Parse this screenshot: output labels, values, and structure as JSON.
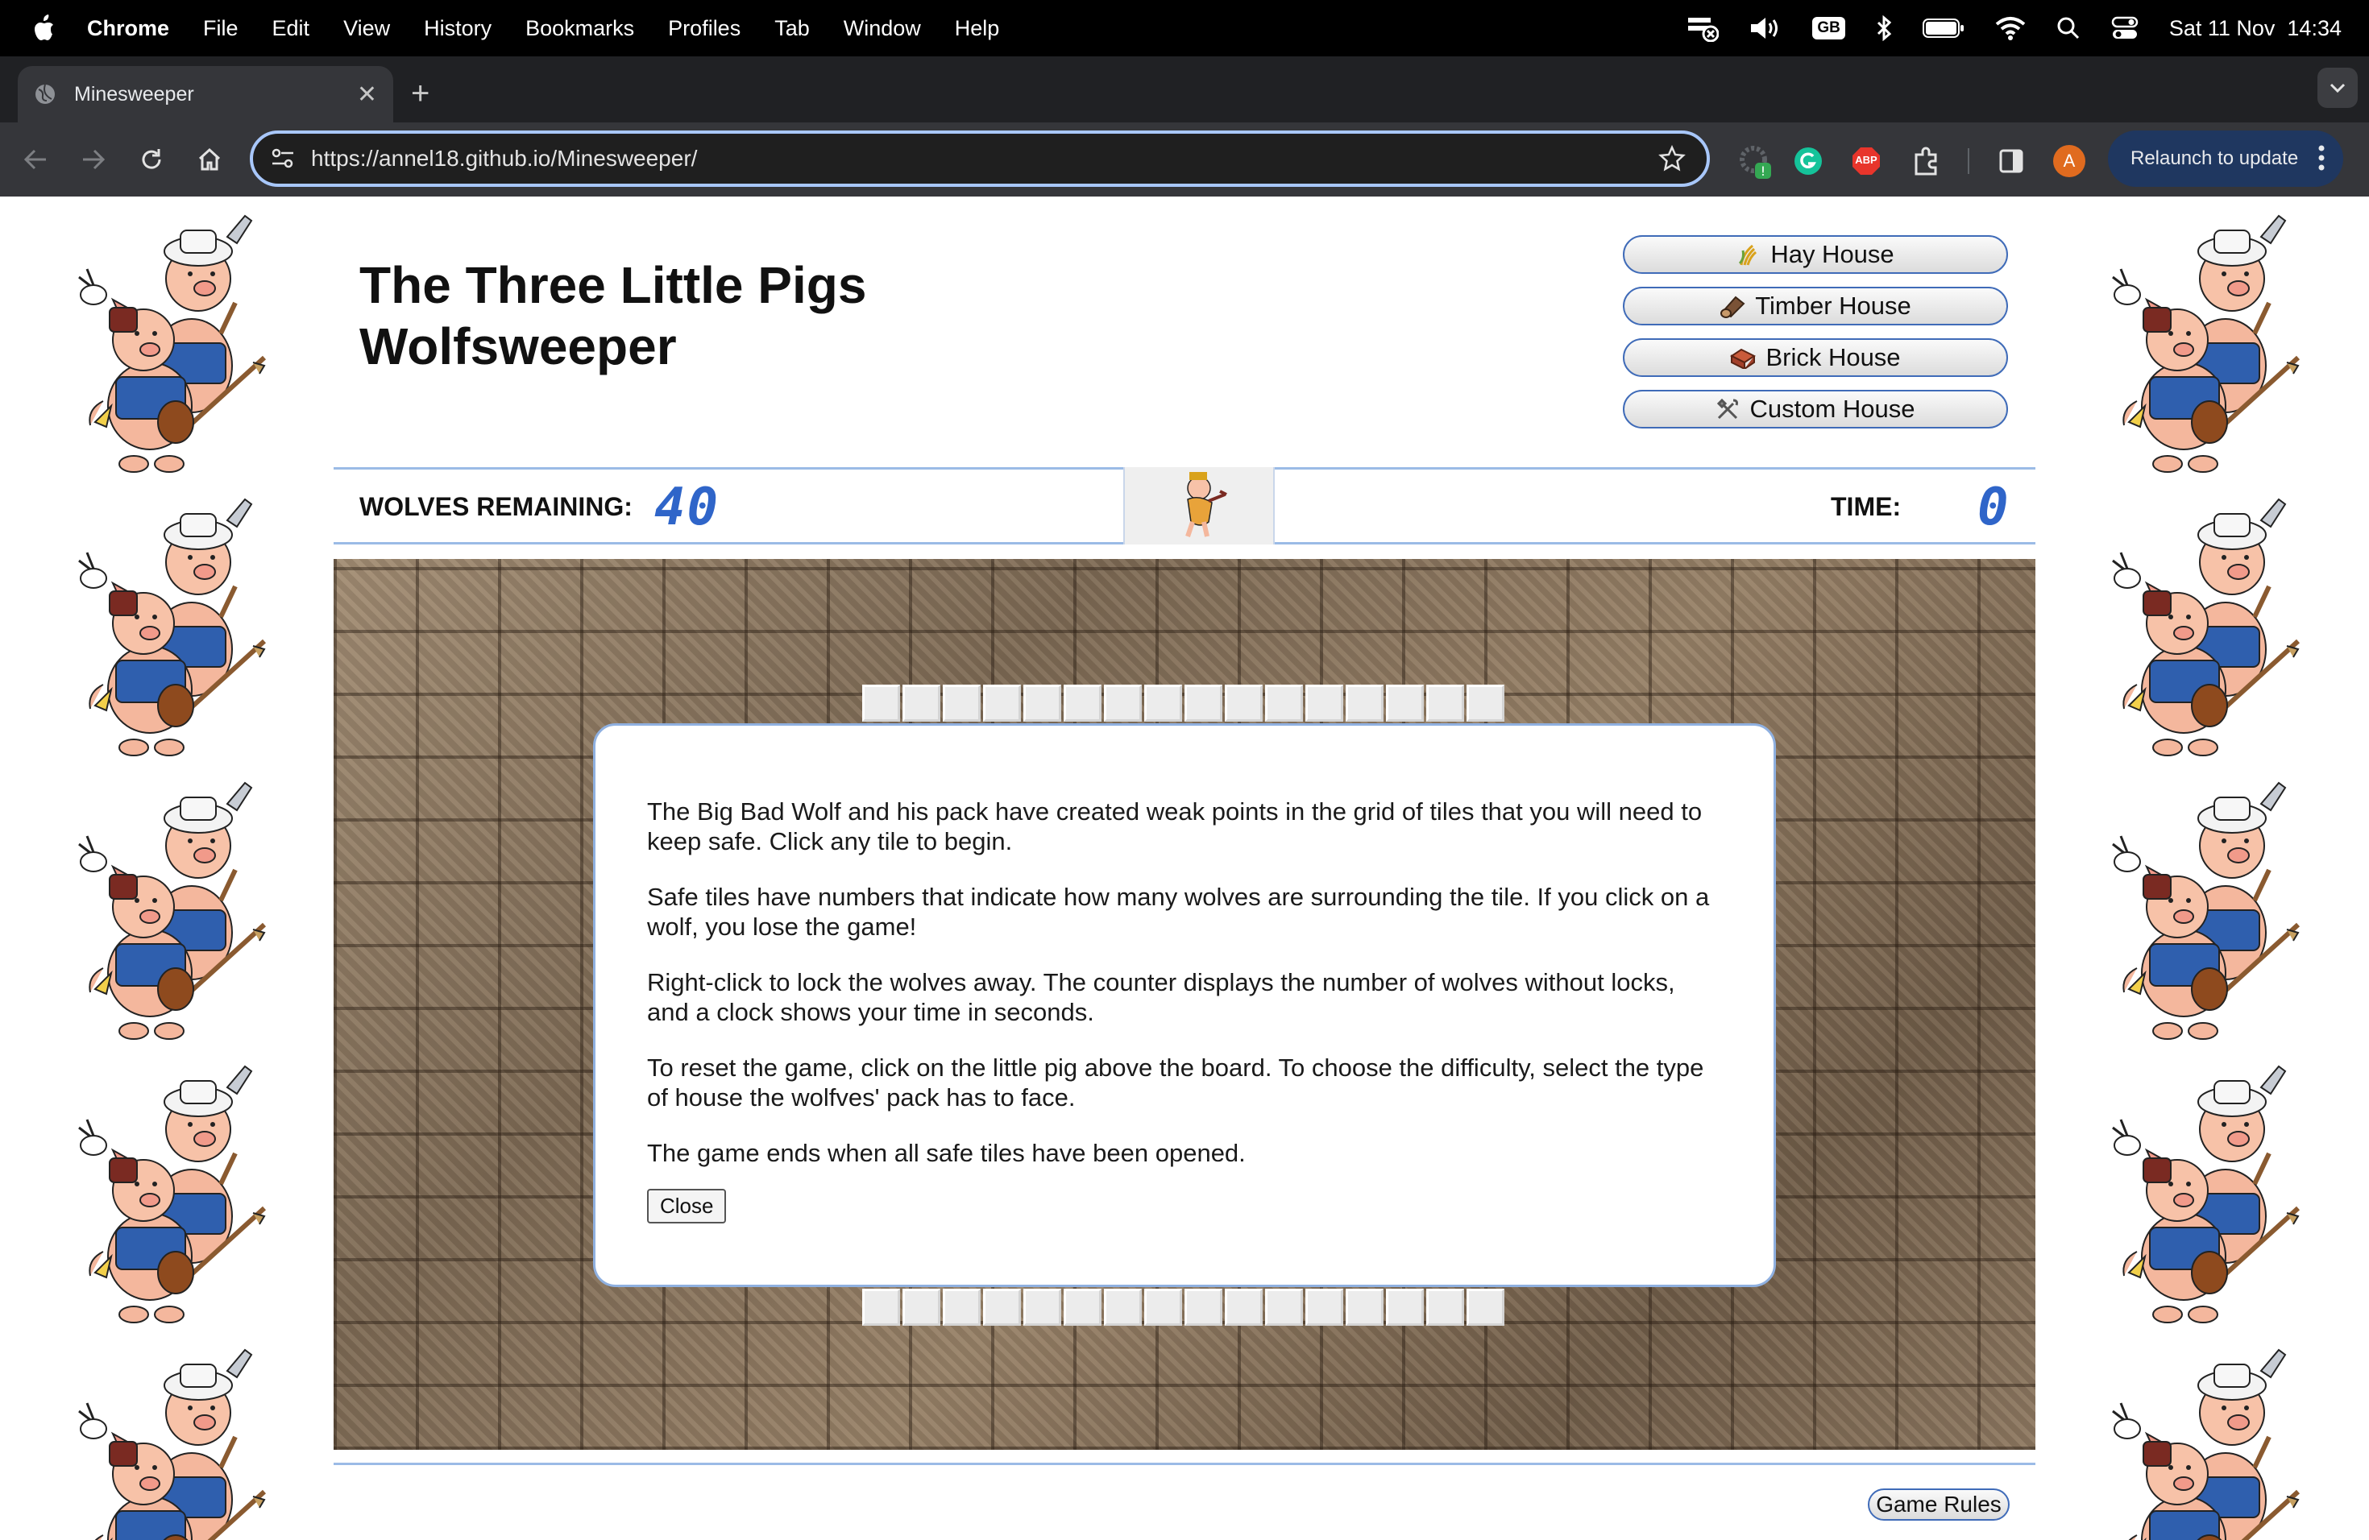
{
  "menubar": {
    "app_name": "Chrome",
    "items": [
      "File",
      "Edit",
      "View",
      "History",
      "Bookmarks",
      "Profiles",
      "Tab",
      "Window",
      "Help"
    ],
    "keyboard_badge": "GB",
    "clock": "Sat 11 Nov  14:34"
  },
  "browser": {
    "tab_title": "Minesweeper",
    "url_prefix": "https://",
    "url_host": "annel18.github.io",
    "url_path": "/Minesweeper/",
    "extension_abp": "ABP",
    "profile_initial": "A",
    "relaunch_label": "Relaunch to update"
  },
  "game": {
    "title": "The Three Little Pigs\nWolfsweeper",
    "houses": [
      {
        "icon": "hay-icon",
        "label": "Hay House"
      },
      {
        "icon": "timber-icon",
        "label": "Timber House"
      },
      {
        "icon": "brick-icon",
        "label": "Brick House"
      },
      {
        "icon": "tools-icon",
        "label": "Custom House"
      }
    ],
    "wolves_label": "WOLVES REMAINING:",
    "wolves_count": "40",
    "time_label": "TIME:",
    "time_value": "0",
    "tile_row_count": 16
  },
  "rules_modal": {
    "paragraphs": [
      "The Big Bad Wolf and his pack have created weak points in the grid of tiles that you will need to keep safe. Click any tile to begin.",
      "Safe tiles have numbers that indicate how many wolves are surrounding the tile. If you click on a wolf, you lose the game!",
      "Right-click to lock the wolves away. The counter displays the number of wolves without locks, and a clock shows your time in seconds.",
      "To reset the game, click on the little pig above the board. To choose the difficulty, select the type of house the wolfves' pack has to face.",
      "The game ends when all safe tiles have been opened."
    ],
    "close_label": "Close"
  },
  "footer": {
    "rules_label": "Game Rules"
  },
  "colors": {
    "accent": "#3f6bb8",
    "lcd": "#2f65c9",
    "rule_line": "#9bbbe6"
  }
}
